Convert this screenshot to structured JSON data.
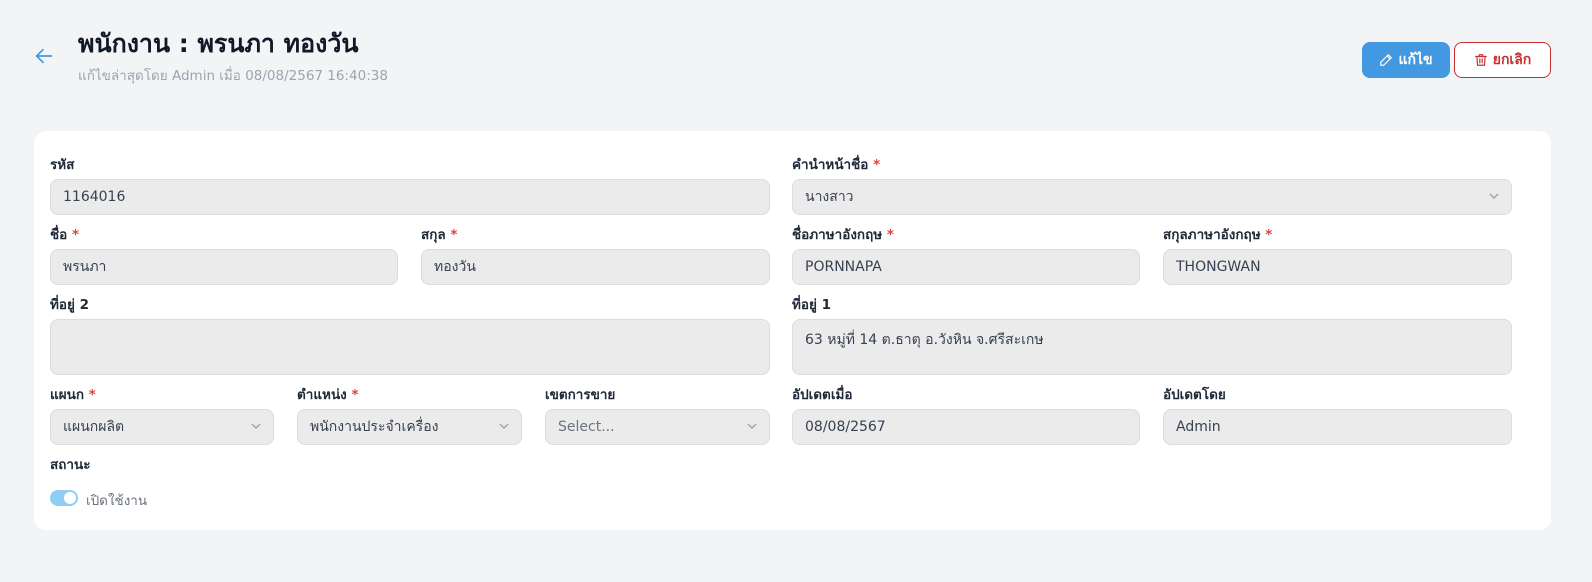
{
  "header": {
    "title": "พนักงาน : พรนภา ทองวัน",
    "subtitle": "แก้ไขล่าสุดโดย Admin เมื่อ 08/08/2567 16:40:38",
    "edit_label": "แก้ไข",
    "cancel_label": "ยกเลิก"
  },
  "form": {
    "code": {
      "label": "รหัส",
      "value": "1164016"
    },
    "prefix": {
      "label": "คำนำหน้าชื่อ",
      "value": "นางสาว"
    },
    "first_name": {
      "label": "ชื่อ",
      "value": "พรนภา"
    },
    "last_name": {
      "label": "สกุล",
      "value": "ทองวัน"
    },
    "first_name_en": {
      "label": "ชื่อภาษาอังกฤษ",
      "value": "PORNNAPA"
    },
    "last_name_en": {
      "label": "สกุลภาษาอังกฤษ",
      "value": "THONGWAN"
    },
    "address2": {
      "label": "ที่อยู่ 2",
      "value": ""
    },
    "address1": {
      "label": "ที่อยู่ 1",
      "value": "63 หมู่ที่ 14 ต.ธาตุ อ.วังหิน จ.ศรีสะเกษ"
    },
    "department": {
      "label": "แผนก",
      "value": "แผนกผลิต"
    },
    "position": {
      "label": "ตำแหน่ง",
      "value": "พนักงานประจำเครื่อง"
    },
    "sales_zone": {
      "label": "เขตการขาย",
      "placeholder": "Select..."
    },
    "updated_at": {
      "label": "อัปเดตเมื่อ",
      "value": "08/08/2567"
    },
    "updated_by": {
      "label": "อัปเดตโดย",
      "value": "Admin"
    },
    "status": {
      "label": "สถานะ",
      "toggle_label": "เปิดใช้งาน",
      "enabled": true
    }
  },
  "required_mark": "*",
  "colors": {
    "primary": "#4299e1",
    "danger": "#c53030",
    "required": "#e53e3e",
    "toggle_on": "#90cdf4"
  }
}
